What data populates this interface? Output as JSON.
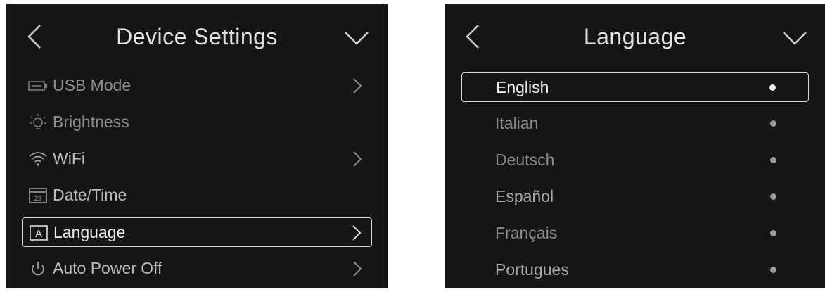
{
  "device_settings": {
    "title": "Device Settings",
    "items": [
      {
        "label": "USB Mode",
        "icon": "usb-icon",
        "has_arrow": true
      },
      {
        "label": "Brightness",
        "icon": "brightness-icon",
        "has_arrow": false
      },
      {
        "label": "WiFi",
        "icon": "wifi-icon",
        "has_arrow": true
      },
      {
        "label": "Date/Time",
        "icon": "calendar-icon",
        "has_arrow": false
      },
      {
        "label": "Language",
        "icon": "language-icon",
        "has_arrow": true,
        "selected": true
      },
      {
        "label": "Auto Power Off",
        "icon": "power-icon",
        "has_arrow": true
      }
    ]
  },
  "language": {
    "title": "Language",
    "options": [
      {
        "label": "English",
        "selected": true
      },
      {
        "label": "Italian"
      },
      {
        "label": "Deutsch"
      },
      {
        "label": "Español"
      },
      {
        "label": "Français"
      },
      {
        "label": "Portugues"
      }
    ]
  },
  "colors": {
    "screen_background": "#151515",
    "text": "#cfcfcf",
    "highlight_border": "#d8d8d8"
  }
}
